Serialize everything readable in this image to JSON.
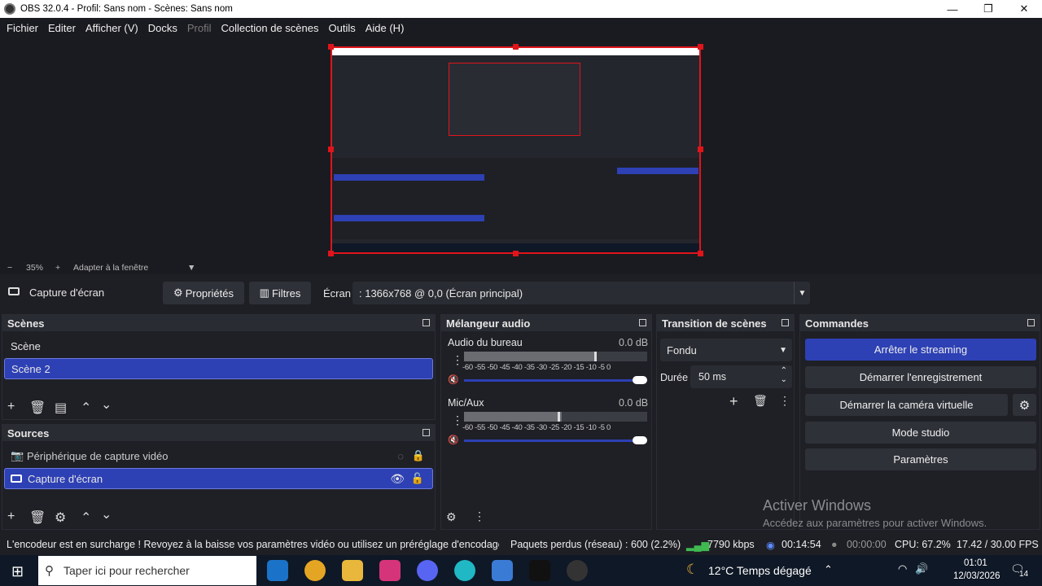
{
  "window": {
    "title": "OBS 32.0.4 - Profil: Sans nom - Scènes: Sans nom",
    "minimize": "—",
    "restore": "❐",
    "close": "✕"
  },
  "menu": [
    "Fichier",
    "Editer",
    "Afficher (V)",
    "Docks",
    "Profil",
    "Collection de scènes",
    "Outils",
    "Aide (H)"
  ],
  "zoom": {
    "minus": "−",
    "value": "35%",
    "plus": "+",
    "fit": "Adapter à la fenêtre"
  },
  "source_toolbar": {
    "source": "Capture d'écran",
    "properties": "Propriétés",
    "filters": "Filtres",
    "screen_label": "Écran",
    "screen_value": ": 1366x768 @ 0,0 (Écran principal)"
  },
  "scenes": {
    "title": "Scènes",
    "items": [
      "Scène",
      "Scène 2"
    ]
  },
  "sources": {
    "title": "Sources",
    "items": [
      "Périphérique de capture vidéo",
      "Capture d'écran"
    ]
  },
  "mixer": {
    "title": "Mélangeur audio",
    "channels": [
      {
        "name": "Audio du bureau",
        "db": "0.0 dB"
      },
      {
        "name": "Mic/Aux",
        "db": "0.0 dB"
      }
    ],
    "ticks": "-60 -55 -50 -45 -40 -35 -30 -25 -20 -15 -10 -5 0"
  },
  "transition": {
    "title": "Transition de scènes",
    "type": "Fondu",
    "duration_label": "Durée",
    "duration_value": "50 ms"
  },
  "commands": {
    "title": "Commandes",
    "buttons": [
      "Arrêter le streaming",
      "Démarrer l'enregistrement",
      "Démarrer la caméra virtuelle",
      "Mode studio",
      "Paramètres"
    ]
  },
  "watermark": {
    "line1": "Activer Windows",
    "line2": "Accédez aux paramètres pour activer Windows."
  },
  "status": {
    "message": "L'encodeur est en surcharge ! Revoyez à la baisse vos paramètres vidéo ou utilisez un préréglage d'encodage p",
    "dropped": "Paquets perdus (réseau) : 600 (2.2%)",
    "bitrate": "7790 kbps",
    "stream_time": "00:14:54",
    "rec_time": "00:00:00",
    "cpu": "CPU: 67.2%",
    "fps": "17.42 / 30.00 FPS"
  },
  "taskbar": {
    "search": "Taper ici pour rechercher",
    "weather": "12°C  Temps dégagé",
    "time": "01:01",
    "date": "12/03/2026",
    "notifications": "14"
  },
  "colors": {
    "accent": "#2d40b4",
    "bg": "#1e1f24",
    "selection_border": "#e0141b"
  }
}
